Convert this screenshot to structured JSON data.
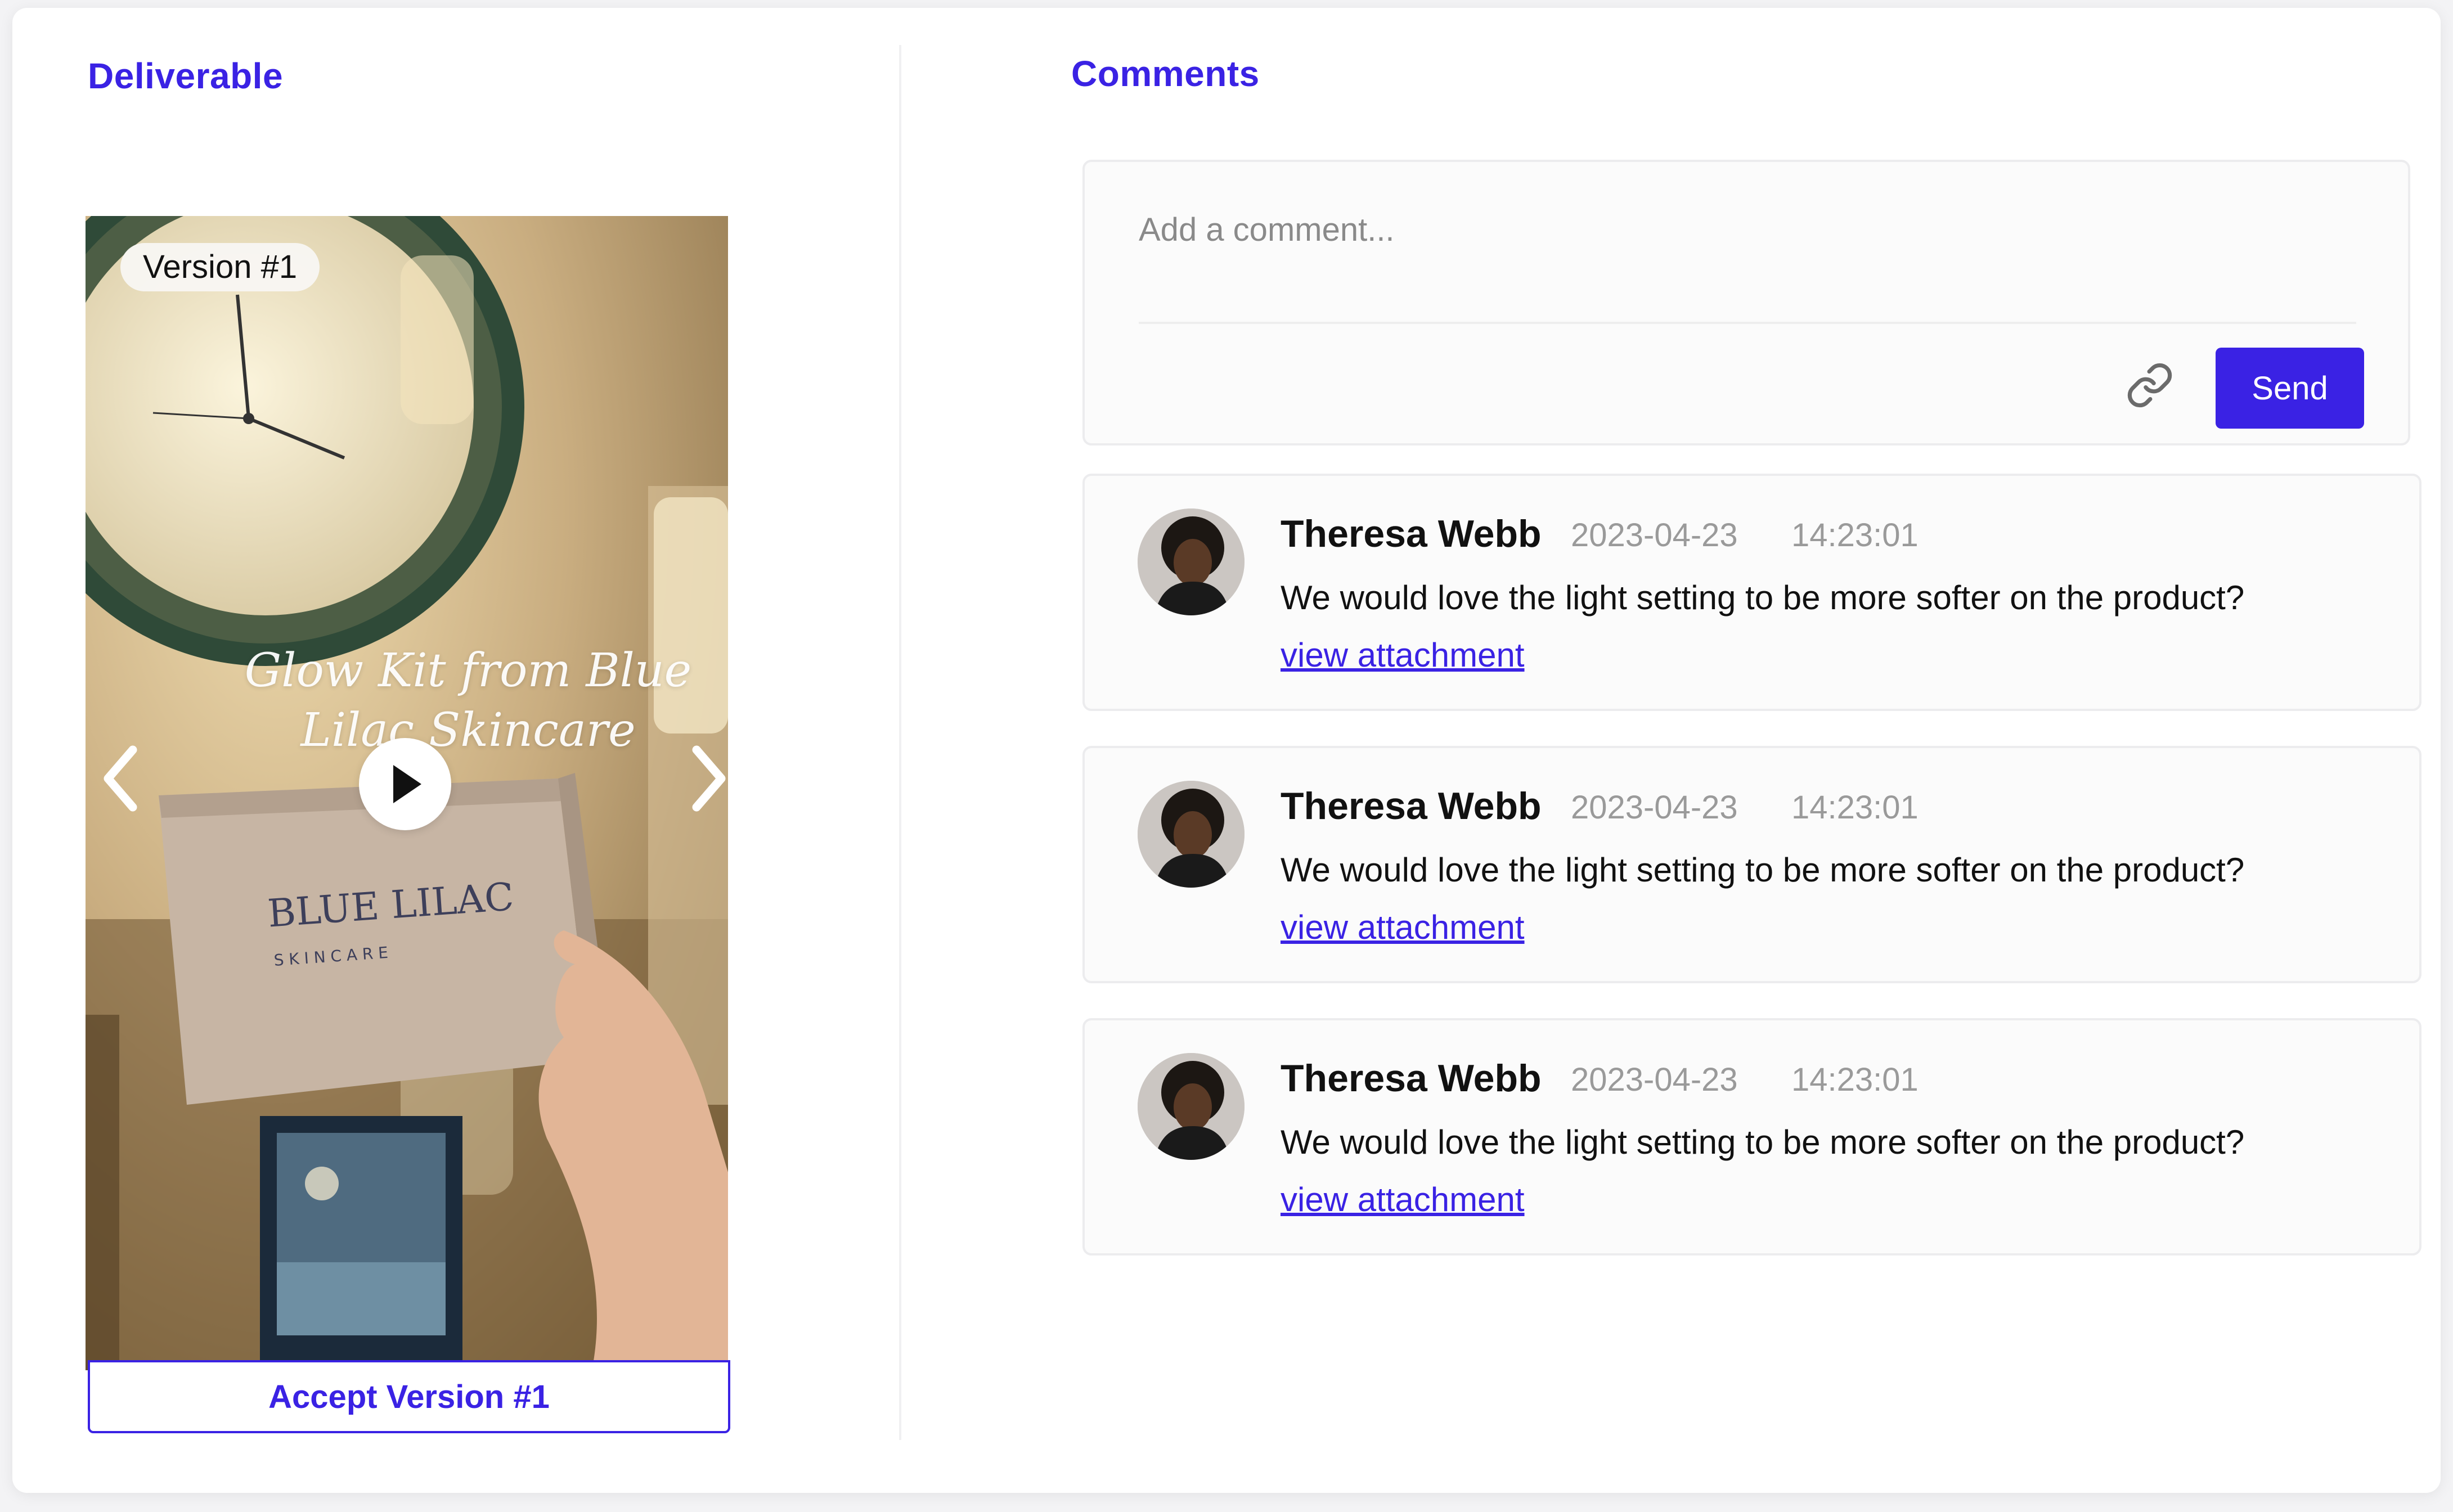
{
  "deliverable": {
    "title": "Deliverable",
    "version_badge": "Version #1",
    "caption": "Glow Kit from Blue Lilac Skincare",
    "brand_text": "BLUE LILAC",
    "brand_subtext": "S K I N C A R E",
    "accept_label": "Accept Version #1"
  },
  "comments_section": {
    "title": "Comments",
    "input_placeholder": "Add a comment...",
    "send_label": "Send"
  },
  "comments": [
    {
      "author": "Theresa Webb",
      "date": "2023-04-23",
      "time": "14:23:01",
      "text": "We would love the light setting to be more softer on the product?",
      "link_label": "view attachment"
    },
    {
      "author": "Theresa Webb",
      "date": "2023-04-23",
      "time": "14:23:01",
      "text": "We would love the light setting to be more softer on the product?",
      "link_label": "view attachment"
    },
    {
      "author": "Theresa Webb",
      "date": "2023-04-23",
      "time": "14:23:01",
      "text": "We would love the light setting to be more softer on the product?",
      "link_label": "view attachment"
    }
  ],
  "colors": {
    "accent": "#3a22e4",
    "muted_text": "#9a9a9a",
    "card_border": "#ececee"
  },
  "icons": [
    "chevron-left-icon",
    "chevron-right-icon",
    "play-icon",
    "link-icon"
  ]
}
